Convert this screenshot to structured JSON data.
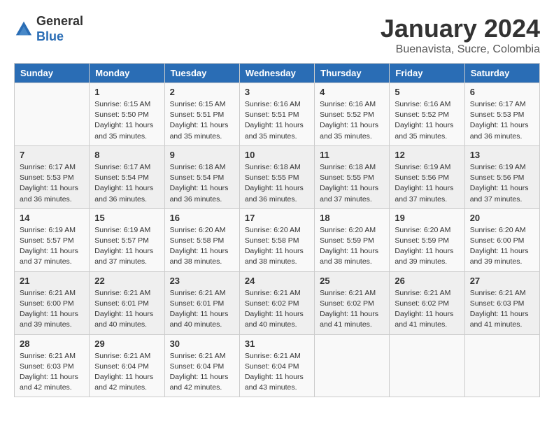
{
  "logo": {
    "general": "General",
    "blue": "Blue"
  },
  "header": {
    "month": "January 2024",
    "location": "Buenavista, Sucre, Colombia"
  },
  "columns": [
    "Sunday",
    "Monday",
    "Tuesday",
    "Wednesday",
    "Thursday",
    "Friday",
    "Saturday"
  ],
  "weeks": [
    [
      {
        "day": "",
        "sunrise": "",
        "sunset": "",
        "daylight": ""
      },
      {
        "day": "1",
        "sunrise": "Sunrise: 6:15 AM",
        "sunset": "Sunset: 5:50 PM",
        "daylight": "Daylight: 11 hours and 35 minutes."
      },
      {
        "day": "2",
        "sunrise": "Sunrise: 6:15 AM",
        "sunset": "Sunset: 5:51 PM",
        "daylight": "Daylight: 11 hours and 35 minutes."
      },
      {
        "day": "3",
        "sunrise": "Sunrise: 6:16 AM",
        "sunset": "Sunset: 5:51 PM",
        "daylight": "Daylight: 11 hours and 35 minutes."
      },
      {
        "day": "4",
        "sunrise": "Sunrise: 6:16 AM",
        "sunset": "Sunset: 5:52 PM",
        "daylight": "Daylight: 11 hours and 35 minutes."
      },
      {
        "day": "5",
        "sunrise": "Sunrise: 6:16 AM",
        "sunset": "Sunset: 5:52 PM",
        "daylight": "Daylight: 11 hours and 35 minutes."
      },
      {
        "day": "6",
        "sunrise": "Sunrise: 6:17 AM",
        "sunset": "Sunset: 5:53 PM",
        "daylight": "Daylight: 11 hours and 36 minutes."
      }
    ],
    [
      {
        "day": "7",
        "sunrise": "Sunrise: 6:17 AM",
        "sunset": "Sunset: 5:53 PM",
        "daylight": "Daylight: 11 hours and 36 minutes."
      },
      {
        "day": "8",
        "sunrise": "Sunrise: 6:17 AM",
        "sunset": "Sunset: 5:54 PM",
        "daylight": "Daylight: 11 hours and 36 minutes."
      },
      {
        "day": "9",
        "sunrise": "Sunrise: 6:18 AM",
        "sunset": "Sunset: 5:54 PM",
        "daylight": "Daylight: 11 hours and 36 minutes."
      },
      {
        "day": "10",
        "sunrise": "Sunrise: 6:18 AM",
        "sunset": "Sunset: 5:55 PM",
        "daylight": "Daylight: 11 hours and 36 minutes."
      },
      {
        "day": "11",
        "sunrise": "Sunrise: 6:18 AM",
        "sunset": "Sunset: 5:55 PM",
        "daylight": "Daylight: 11 hours and 37 minutes."
      },
      {
        "day": "12",
        "sunrise": "Sunrise: 6:19 AM",
        "sunset": "Sunset: 5:56 PM",
        "daylight": "Daylight: 11 hours and 37 minutes."
      },
      {
        "day": "13",
        "sunrise": "Sunrise: 6:19 AM",
        "sunset": "Sunset: 5:56 PM",
        "daylight": "Daylight: 11 hours and 37 minutes."
      }
    ],
    [
      {
        "day": "14",
        "sunrise": "Sunrise: 6:19 AM",
        "sunset": "Sunset: 5:57 PM",
        "daylight": "Daylight: 11 hours and 37 minutes."
      },
      {
        "day": "15",
        "sunrise": "Sunrise: 6:19 AM",
        "sunset": "Sunset: 5:57 PM",
        "daylight": "Daylight: 11 hours and 37 minutes."
      },
      {
        "day": "16",
        "sunrise": "Sunrise: 6:20 AM",
        "sunset": "Sunset: 5:58 PM",
        "daylight": "Daylight: 11 hours and 38 minutes."
      },
      {
        "day": "17",
        "sunrise": "Sunrise: 6:20 AM",
        "sunset": "Sunset: 5:58 PM",
        "daylight": "Daylight: 11 hours and 38 minutes."
      },
      {
        "day": "18",
        "sunrise": "Sunrise: 6:20 AM",
        "sunset": "Sunset: 5:59 PM",
        "daylight": "Daylight: 11 hours and 38 minutes."
      },
      {
        "day": "19",
        "sunrise": "Sunrise: 6:20 AM",
        "sunset": "Sunset: 5:59 PM",
        "daylight": "Daylight: 11 hours and 39 minutes."
      },
      {
        "day": "20",
        "sunrise": "Sunrise: 6:20 AM",
        "sunset": "Sunset: 6:00 PM",
        "daylight": "Daylight: 11 hours and 39 minutes."
      }
    ],
    [
      {
        "day": "21",
        "sunrise": "Sunrise: 6:21 AM",
        "sunset": "Sunset: 6:00 PM",
        "daylight": "Daylight: 11 hours and 39 minutes."
      },
      {
        "day": "22",
        "sunrise": "Sunrise: 6:21 AM",
        "sunset": "Sunset: 6:01 PM",
        "daylight": "Daylight: 11 hours and 40 minutes."
      },
      {
        "day": "23",
        "sunrise": "Sunrise: 6:21 AM",
        "sunset": "Sunset: 6:01 PM",
        "daylight": "Daylight: 11 hours and 40 minutes."
      },
      {
        "day": "24",
        "sunrise": "Sunrise: 6:21 AM",
        "sunset": "Sunset: 6:02 PM",
        "daylight": "Daylight: 11 hours and 40 minutes."
      },
      {
        "day": "25",
        "sunrise": "Sunrise: 6:21 AM",
        "sunset": "Sunset: 6:02 PM",
        "daylight": "Daylight: 11 hours and 41 minutes."
      },
      {
        "day": "26",
        "sunrise": "Sunrise: 6:21 AM",
        "sunset": "Sunset: 6:02 PM",
        "daylight": "Daylight: 11 hours and 41 minutes."
      },
      {
        "day": "27",
        "sunrise": "Sunrise: 6:21 AM",
        "sunset": "Sunset: 6:03 PM",
        "daylight": "Daylight: 11 hours and 41 minutes."
      }
    ],
    [
      {
        "day": "28",
        "sunrise": "Sunrise: 6:21 AM",
        "sunset": "Sunset: 6:03 PM",
        "daylight": "Daylight: 11 hours and 42 minutes."
      },
      {
        "day": "29",
        "sunrise": "Sunrise: 6:21 AM",
        "sunset": "Sunset: 6:04 PM",
        "daylight": "Daylight: 11 hours and 42 minutes."
      },
      {
        "day": "30",
        "sunrise": "Sunrise: 6:21 AM",
        "sunset": "Sunset: 6:04 PM",
        "daylight": "Daylight: 11 hours and 42 minutes."
      },
      {
        "day": "31",
        "sunrise": "Sunrise: 6:21 AM",
        "sunset": "Sunset: 6:04 PM",
        "daylight": "Daylight: 11 hours and 43 minutes."
      },
      {
        "day": "",
        "sunrise": "",
        "sunset": "",
        "daylight": ""
      },
      {
        "day": "",
        "sunrise": "",
        "sunset": "",
        "daylight": ""
      },
      {
        "day": "",
        "sunrise": "",
        "sunset": "",
        "daylight": ""
      }
    ]
  ]
}
